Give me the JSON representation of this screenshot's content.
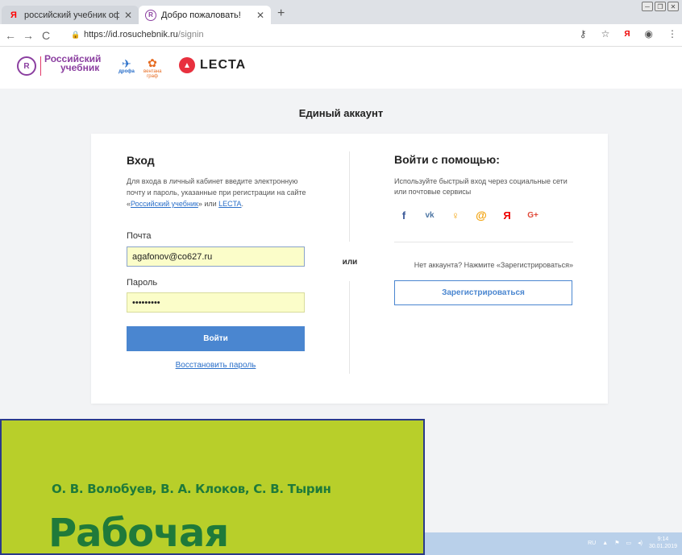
{
  "browser": {
    "tabs": [
      {
        "label": "российский учебник официаль",
        "favicon": "yandex-icon"
      },
      {
        "label": "Добро пожаловать!",
        "favicon": "rosuchebnik-icon"
      }
    ],
    "url_host": "https://id.rosuchebnik.ru",
    "url_path": "/signin"
  },
  "header": {
    "logo_line1": "Российский",
    "logo_line2": "учебник",
    "drofa": "дрофа",
    "ventana": "вентана граф",
    "lecta": "LECTA"
  },
  "page": {
    "title": "Единый аккаунт"
  },
  "login": {
    "heading": "Вход",
    "desc_part1": "Для входа в личный кабинет введите электронную почту и пароль, указанные при регистрации на сайте «",
    "desc_link1": "Российский учебник",
    "desc_part2": "» или ",
    "desc_link2": "LECTA",
    "desc_part3": ".",
    "email_label": "Почта",
    "email_value": "agafonov@co627.ru",
    "password_label": "Пароль",
    "password_value": "•••••••••",
    "submit": "Войти",
    "restore": "Восстановить пароль"
  },
  "or_text": "или",
  "social": {
    "heading": "Войти с помощью:",
    "desc": "Используйте быстрый вход через социальные сети или почтовые сервисы",
    "icons": [
      {
        "name": "facebook-icon",
        "glyph": "f"
      },
      {
        "name": "vk-icon",
        "glyph": "vk"
      },
      {
        "name": "odnoklassniki-icon",
        "glyph": "ок"
      },
      {
        "name": "mailru-icon",
        "glyph": "@"
      },
      {
        "name": "yandex-icon",
        "glyph": "Я"
      },
      {
        "name": "googleplus-icon",
        "glyph": "G+"
      }
    ],
    "no_account": "Нет аккаунта? Нажмите «Зарегистрироваться»",
    "register": "Зарегистрироваться"
  },
  "taskbar": {
    "lang": "RU",
    "time": "9:14",
    "date": "30.01.2019"
  },
  "cover": {
    "authors": "О. В. Волобуев, В. А. Клоков, С. В. Тырин",
    "title": "Рабочая"
  },
  "colors": {
    "accent": "#4a86d0",
    "brand_purple": "#8b3fa0",
    "lecta_red": "#e8303e",
    "cover_bg": "#b8cf2a",
    "cover_text": "#1f7a3a"
  }
}
